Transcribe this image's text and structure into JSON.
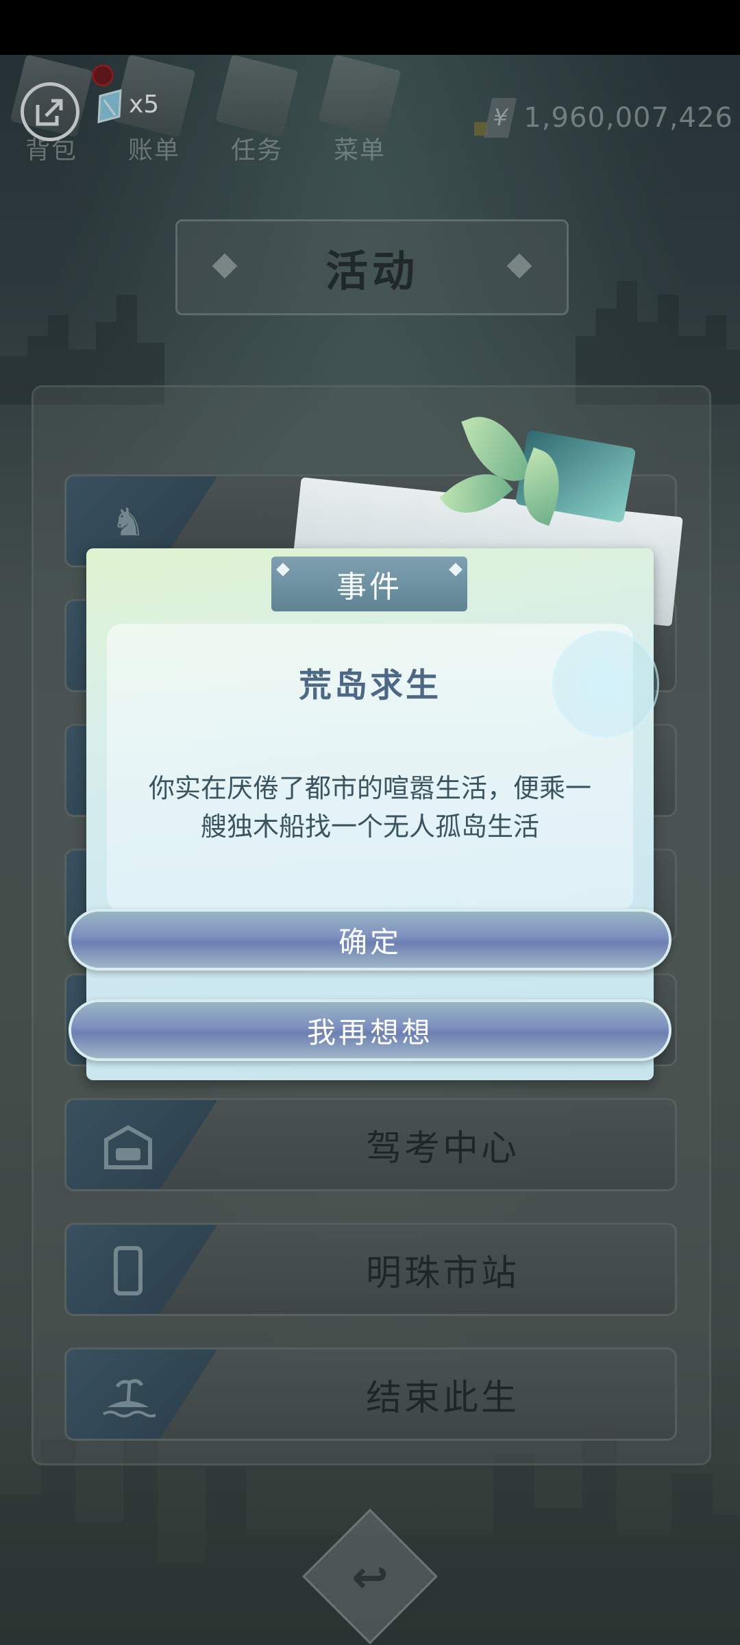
{
  "top_bar": {
    "items": [
      {
        "label": "背包",
        "icon": "bag-icon"
      },
      {
        "label": "账单",
        "icon": "bill-icon"
      },
      {
        "label": "任务",
        "icon": "task-icon"
      },
      {
        "label": "菜单",
        "icon": "menu-icon"
      }
    ],
    "ticket_count": "x5",
    "money_symbol": "¥",
    "money": "1,960,007,426"
  },
  "page_title": "活动",
  "menu": {
    "items": [
      {
        "label": "棋牌中心",
        "icon": "chess-icon"
      },
      {
        "label": "",
        "icon": "activity-icon"
      },
      {
        "label": "",
        "icon": "activity-icon"
      },
      {
        "label": "",
        "icon": "activity-icon"
      },
      {
        "label": "",
        "icon": "activity-icon"
      },
      {
        "label": "驾考中心",
        "icon": "garage-car-icon"
      },
      {
        "label": "明珠市站",
        "icon": "phone-icon"
      },
      {
        "label": "结束此生",
        "icon": "island-icon"
      }
    ]
  },
  "dialog": {
    "tab": "事件",
    "title": "荒岛求生",
    "text_line1": "你实在厌倦了都市的喧嚣生活，便乘一",
    "text_line2": "艘独木船找一个无人孤岛生活",
    "confirm": "确定",
    "reconsider": "我再想想"
  },
  "colors": {
    "dialog_title": "#4c6884",
    "button_fill": "#7c8fbf",
    "tab_fill": "#6f92a2"
  }
}
